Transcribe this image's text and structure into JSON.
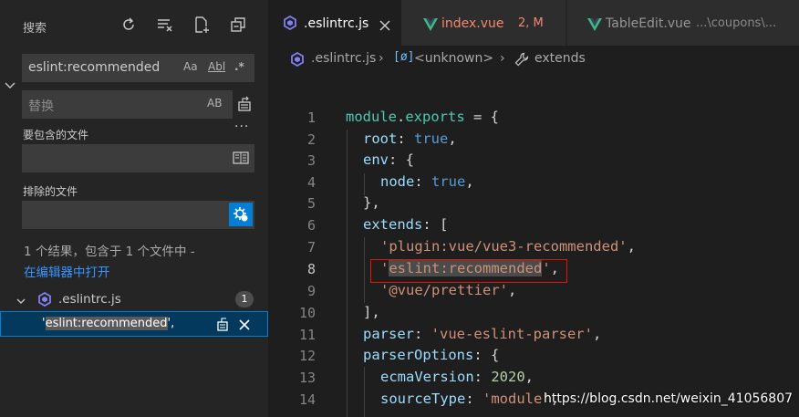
{
  "search_panel": {
    "title": "搜索",
    "search_value": "eslint:recommended",
    "search_options": {
      "match_case": "Aa",
      "whole_word": "Abl",
      "regex": ".*"
    },
    "replace_placeholder": "替换",
    "replace_preserve_case": "AB",
    "more_label": "···",
    "include_label": "要包含的文件",
    "exclude_label": "排除的文件",
    "summary": "1 个结果，包含于 1 个文件中 -",
    "open_in_editor": "在编辑器中打开",
    "file": {
      "name": ".eslintrc.js",
      "count": "1"
    },
    "match": {
      "before": "'",
      "highlight": "eslint:recommended",
      "after": "',"
    }
  },
  "tabs": [
    {
      "label": ".eslintrc.js",
      "active": true
    },
    {
      "label": "index.vue",
      "status": "2, M"
    },
    {
      "label": "TableEdit.vue",
      "path": "...\\coupons\\..."
    }
  ],
  "breadcrumb": {
    "file": ".eslintrc.js",
    "scope": "<unknown>",
    "symbol": "extends"
  },
  "code": {
    "line_numbers": [
      "1",
      "2",
      "3",
      "4",
      "5",
      "6",
      "7",
      "8",
      "9",
      "10",
      "11",
      "12",
      "13",
      "14"
    ],
    "current_line": "8",
    "lines": [
      {
        "t1": "module",
        "t2": ".",
        "t3": "exports",
        "t4": " = {"
      },
      {
        "t1": "root",
        "t2": ": ",
        "t3": "true",
        "t4": ","
      },
      {
        "t1": "env",
        "t2": ": {"
      },
      {
        "t1": "node",
        "t2": ": ",
        "t3": "true",
        "t4": ","
      },
      {
        "t1": "},"
      },
      {
        "t1": "extends",
        "t2": ": ["
      },
      {
        "t1": "'plugin:vue/vue3-recommended'",
        "t2": ","
      },
      {
        "t1": "'",
        "t2": "eslint:recommended",
        "t3": "'",
        "t4": ","
      },
      {
        "t1": "'@vue/prettier'",
        "t2": ","
      },
      {
        "t1": "],"
      },
      {
        "t1": "parser",
        "t2": ": ",
        "t3": "'vue-eslint-parser'",
        "t4": ","
      },
      {
        "t1": "parserOptions",
        "t2": ": {"
      },
      {
        "t1": "ecmaVersion",
        "t2": ": ",
        "t3": "2020",
        "t4": ","
      },
      {
        "t1": "sourceType",
        "t2": ": ",
        "t3": "'module'",
        "t4": ","
      }
    ]
  },
  "watermark": "https://blog.csdn.net/weixin_41056807",
  "colors": {
    "accent": "#007fd4",
    "link": "#3794ff",
    "vue": "#41b883",
    "eslint": "#8080f2",
    "modified": "#f48771",
    "match_box": "#e51400"
  }
}
